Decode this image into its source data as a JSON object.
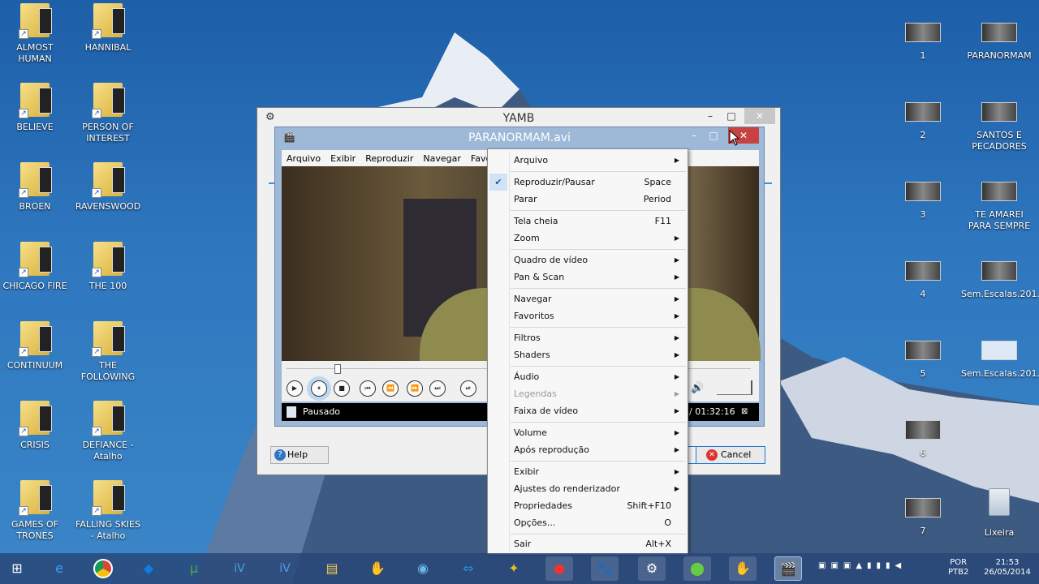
{
  "desktop": {
    "left_icons": [
      {
        "label": "ALMOST HUMAN"
      },
      {
        "label": "HANNIBAL"
      },
      {
        "label": "BELIEVE"
      },
      {
        "label": "PERSON OF INTEREST"
      },
      {
        "label": "BROEN"
      },
      {
        "label": "RAVENSWOOD"
      },
      {
        "label": "CHICAGO FIRE"
      },
      {
        "label": "THE 100"
      },
      {
        "label": "CONTINUUM"
      },
      {
        "label": "THE FOLLOWING"
      },
      {
        "label": "CRISIS"
      },
      {
        "label": "DEFIANCE - Atalho"
      },
      {
        "label": "GAMES OF TRONES"
      },
      {
        "label": "FALLING SKIES - Atalho"
      }
    ],
    "right_icons": [
      {
        "label": "1"
      },
      {
        "label": "PARANORMAM"
      },
      {
        "label": "2"
      },
      {
        "label": "SANTOS E PECADORES"
      },
      {
        "label": "3"
      },
      {
        "label": "TE AMAREI PARA SEMPRE"
      },
      {
        "label": "4"
      },
      {
        "label": "Sem.Escalas.201..."
      },
      {
        "label": "5"
      },
      {
        "label": "Sem.Escalas.201..."
      },
      {
        "label": "6"
      },
      {
        "label": "7"
      },
      {
        "label": "Lixeira"
      }
    ]
  },
  "yamb": {
    "title": "YAMB",
    "help_label": "Help",
    "cancel_label": "Cancel"
  },
  "player": {
    "title": "PARANORMAM.avi",
    "menubar": [
      "Arquivo",
      "Exibir",
      "Reproduzir",
      "Navegar",
      "Favorit"
    ],
    "status": "Pausado",
    "time": "/ 01:32:16"
  },
  "context_menu": {
    "items": [
      {
        "label": "Arquivo",
        "submenu": true
      },
      {
        "label": "Reproduzir/Pausar",
        "shortcut": "Space",
        "checked": true
      },
      {
        "label": "Parar",
        "shortcut": "Period"
      },
      {
        "label": "Tela cheia",
        "shortcut": "F11"
      },
      {
        "label": "Zoom",
        "submenu": true
      },
      {
        "label": "Quadro de vídeo",
        "submenu": true
      },
      {
        "label": "Pan & Scan",
        "submenu": true
      },
      {
        "label": "Navegar",
        "submenu": true
      },
      {
        "label": "Favoritos",
        "submenu": true
      },
      {
        "label": "Filtros",
        "submenu": true
      },
      {
        "label": "Shaders",
        "submenu": true
      },
      {
        "label": "Áudio",
        "submenu": true
      },
      {
        "label": "Legendas",
        "submenu": true,
        "disabled": true
      },
      {
        "label": "Faixa de vídeo",
        "submenu": true
      },
      {
        "label": "Volume",
        "submenu": true
      },
      {
        "label": "Após reprodução",
        "submenu": true
      },
      {
        "label": "Exibir",
        "submenu": true
      },
      {
        "label": "Ajustes do renderizador",
        "submenu": true
      },
      {
        "label": "Propriedades",
        "shortcut": "Shift+F10"
      },
      {
        "label": "Opções...",
        "shortcut": "O"
      },
      {
        "label": "Sair",
        "shortcut": "Alt+X"
      }
    ]
  },
  "tray": {
    "lang1": "POR",
    "lang2": "PTB2",
    "time": "21:53",
    "date": "26/05/2014"
  },
  "icons": {
    "play": "▶",
    "pause": "⏸",
    "stop": "■",
    "prev": "⏮",
    "rew": "⏪",
    "ffw": "⏩",
    "next": "⏭",
    "step": "⏯",
    "check": "✔",
    "arrow": "▶",
    "speaker": "🔊"
  }
}
